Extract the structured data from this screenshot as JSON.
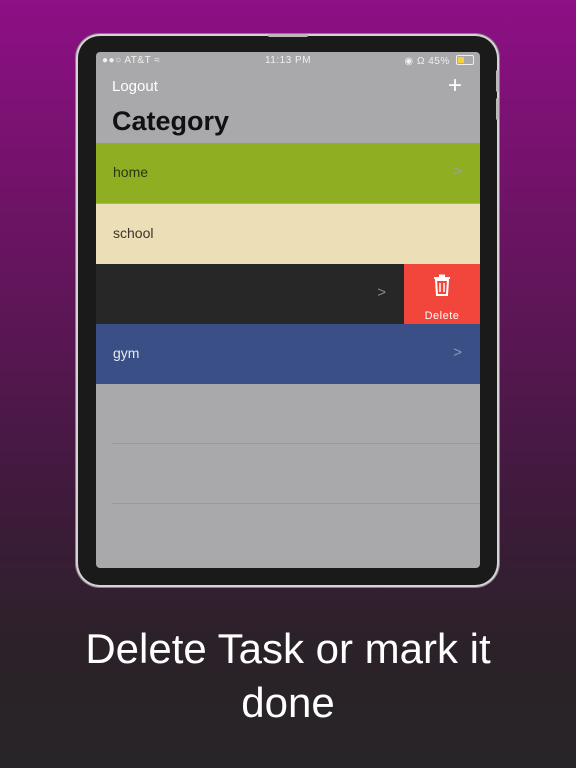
{
  "status_bar": {
    "carrier": "AT&T",
    "time": "11:13 PM",
    "battery": "45%",
    "battery_fill_fraction": 0.45
  },
  "nav": {
    "logout_label": "Logout",
    "add_label": "+"
  },
  "page_title": "Category",
  "categories": [
    {
      "label": "home",
      "color": "#8faf23"
    },
    {
      "label": "school",
      "color": "#ecdfb8"
    },
    {
      "label": "",
      "color": "#272727"
    },
    {
      "label": "gym",
      "color": "#3a4f85"
    }
  ],
  "swipe_action": {
    "label": "Delete",
    "color": "#f2463c",
    "icon": "trash-icon"
  },
  "chevron": ">",
  "caption": {
    "line1": "Delete Task or mark it",
    "line2": "done"
  }
}
